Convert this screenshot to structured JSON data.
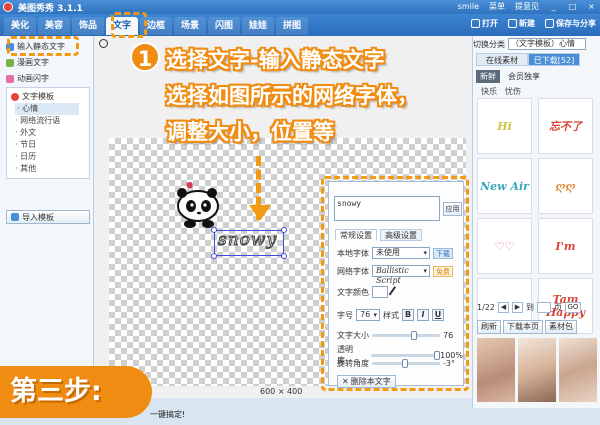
{
  "app": {
    "title": "美图秀秀 3.1.1",
    "titlebar_links": [
      "smile",
      "菜单",
      "提意见"
    ],
    "window_controls": [
      "_",
      "□",
      "×"
    ]
  },
  "nav": {
    "tabs": [
      "美化",
      "美容",
      "饰品",
      "文字",
      "边框",
      "场景",
      "闪图",
      "娃娃",
      "拼图"
    ],
    "active_tab": "文字",
    "actions": [
      "打开",
      "新建",
      "保存与分享"
    ]
  },
  "left_panel": {
    "items": [
      "输入静态文字",
      "漫画文字",
      "动画闪字"
    ],
    "template": {
      "title": "文字模板",
      "list": [
        "心情",
        "网络流行语",
        "外文",
        "节日",
        "日历",
        "其他"
      ]
    },
    "import_label": "导入模板"
  },
  "canvas": {
    "size_readout": "600 × 400",
    "status_text": "一键搞定!",
    "selected_text": "snowy"
  },
  "right_panel": {
    "category_label": "切换分类",
    "category_value": "（文字模板）心情",
    "tabs": [
      "在线素材",
      "已下载[52]"
    ],
    "active_tab": "已下载[52]",
    "sub_tabs": [
      "新鲜",
      "会员独享"
    ],
    "filters": [
      "快乐",
      "忧伤"
    ],
    "thumbs": [
      "Hi",
      "忘不了",
      "New Air",
      "ღღ",
      "♡♡",
      "I'm",
      "▲",
      "Tam Happy"
    ],
    "pager": {
      "current": "1/22",
      "go_prefix": "到",
      "go_suffix": "页",
      "go_button": "GO"
    },
    "buttons": [
      "刷新",
      "下载本页",
      "素材包"
    ]
  },
  "settings": {
    "text_value": "snowy",
    "apply": "应用",
    "tabs": [
      "常规设置",
      "高级设置"
    ],
    "local_font_label": "本地字体",
    "local_font_value": "未使用",
    "local_font_tag": "下载",
    "net_font_label": "网络字体",
    "net_font_value": "Ballistic Script",
    "net_font_tag": "免费",
    "color_label": "文字颜色",
    "size_label": "字号",
    "size_value": "76",
    "style_label": "样式",
    "style_buttons": [
      "B",
      "I",
      "U"
    ],
    "sliders": [
      {
        "label": "文字大小",
        "value": "76",
        "level": 0.62
      },
      {
        "label": "透明度",
        "value": "100%",
        "level": 1.0
      },
      {
        "label": "旋转角度",
        "value": "-3°",
        "level": 0.49
      }
    ],
    "delete_label": "删除本文字"
  },
  "annotation": {
    "step_number": "1",
    "lines": [
      "选择文字-输入静态文字",
      "选择如图所示的网络字体，",
      "调整大小，位置等"
    ],
    "step_badge": "第三步:"
  },
  "colors": {
    "accent": "#f08c12",
    "brand_blue": "#2f73c0",
    "selection": "#3d4fd8"
  }
}
